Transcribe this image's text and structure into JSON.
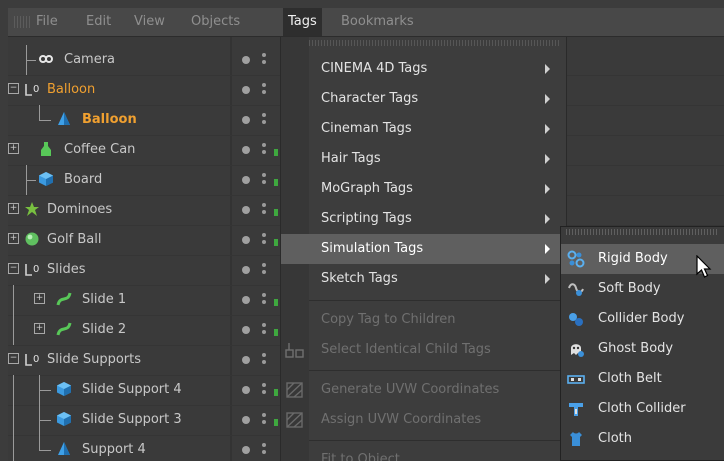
{
  "menubar": {
    "items": [
      {
        "label": "File"
      },
      {
        "label": "Edit"
      },
      {
        "label": "View"
      },
      {
        "label": "Objects"
      },
      {
        "label": "Tags",
        "active": true
      },
      {
        "label": "Bookmarks"
      }
    ]
  },
  "objects": {
    "rows": [
      {
        "label": "Camera",
        "icon": "camera-icon"
      },
      {
        "label": "Balloon",
        "icon": "null-object-icon",
        "color": "#f0a030"
      },
      {
        "label": "Balloon",
        "icon": "cone-primitive-icon",
        "color": "#f0a030"
      },
      {
        "label": "Coffee Can",
        "icon": "bottle-icon"
      },
      {
        "label": "Board",
        "icon": "cube-icon"
      },
      {
        "label": "Dominoes",
        "icon": "cloner-icon"
      },
      {
        "label": "Golf Ball",
        "icon": "sphere-icon"
      },
      {
        "label": "Slides",
        "icon": "null-object-icon"
      },
      {
        "label": "Slide 1",
        "icon": "spline-object-icon"
      },
      {
        "label": "Slide 2",
        "icon": "spline-object-icon"
      },
      {
        "label": "Slide Supports",
        "icon": "null-object-icon"
      },
      {
        "label": "Slide Support 4",
        "icon": "cube-icon"
      },
      {
        "label": "Slide Support 3",
        "icon": "cube-icon"
      },
      {
        "label": "Support 4",
        "icon": "cone-primitive-icon"
      }
    ]
  },
  "tags_menu": {
    "items": [
      {
        "label": "CINEMA 4D Tags",
        "submenu": true
      },
      {
        "label": "Character Tags",
        "submenu": true
      },
      {
        "label": "Cineman Tags",
        "submenu": true
      },
      {
        "label": "Hair Tags",
        "submenu": true
      },
      {
        "label": "MoGraph Tags",
        "submenu": true
      },
      {
        "label": "Scripting Tags",
        "submenu": true
      },
      {
        "label": "Simulation Tags",
        "submenu": true,
        "highlighted": true
      },
      {
        "label": "Sketch Tags",
        "submenu": true
      },
      {
        "label": "Copy Tag to Children",
        "disabled": true
      },
      {
        "label": "Select Identical Child Tags",
        "disabled": true,
        "icon": "select-child-tags-icon"
      },
      {
        "label": "Generate UVW Coordinates",
        "disabled": true,
        "icon": "uvw-generate-icon"
      },
      {
        "label": "Assign UVW Coordinates",
        "disabled": true,
        "icon": "uvw-assign-icon"
      },
      {
        "label": "Fit to Object",
        "disabled": true
      }
    ]
  },
  "simulation_submenu": {
    "items": [
      {
        "label": "Rigid Body",
        "icon": "rigid-body-icon",
        "highlighted": true
      },
      {
        "label": "Soft Body",
        "icon": "soft-body-icon"
      },
      {
        "label": "Collider Body",
        "icon": "collider-body-icon"
      },
      {
        "label": "Ghost Body",
        "icon": "ghost-body-icon"
      },
      {
        "label": "Cloth Belt",
        "icon": "cloth-belt-icon"
      },
      {
        "label": "Cloth Collider",
        "icon": "cloth-collider-icon"
      },
      {
        "label": "Cloth",
        "icon": "cloth-icon"
      }
    ]
  },
  "colors": {
    "highlight": "#5f5f5f",
    "orange_text": "#f0a030",
    "menu_bg": "#3d3d3d"
  }
}
